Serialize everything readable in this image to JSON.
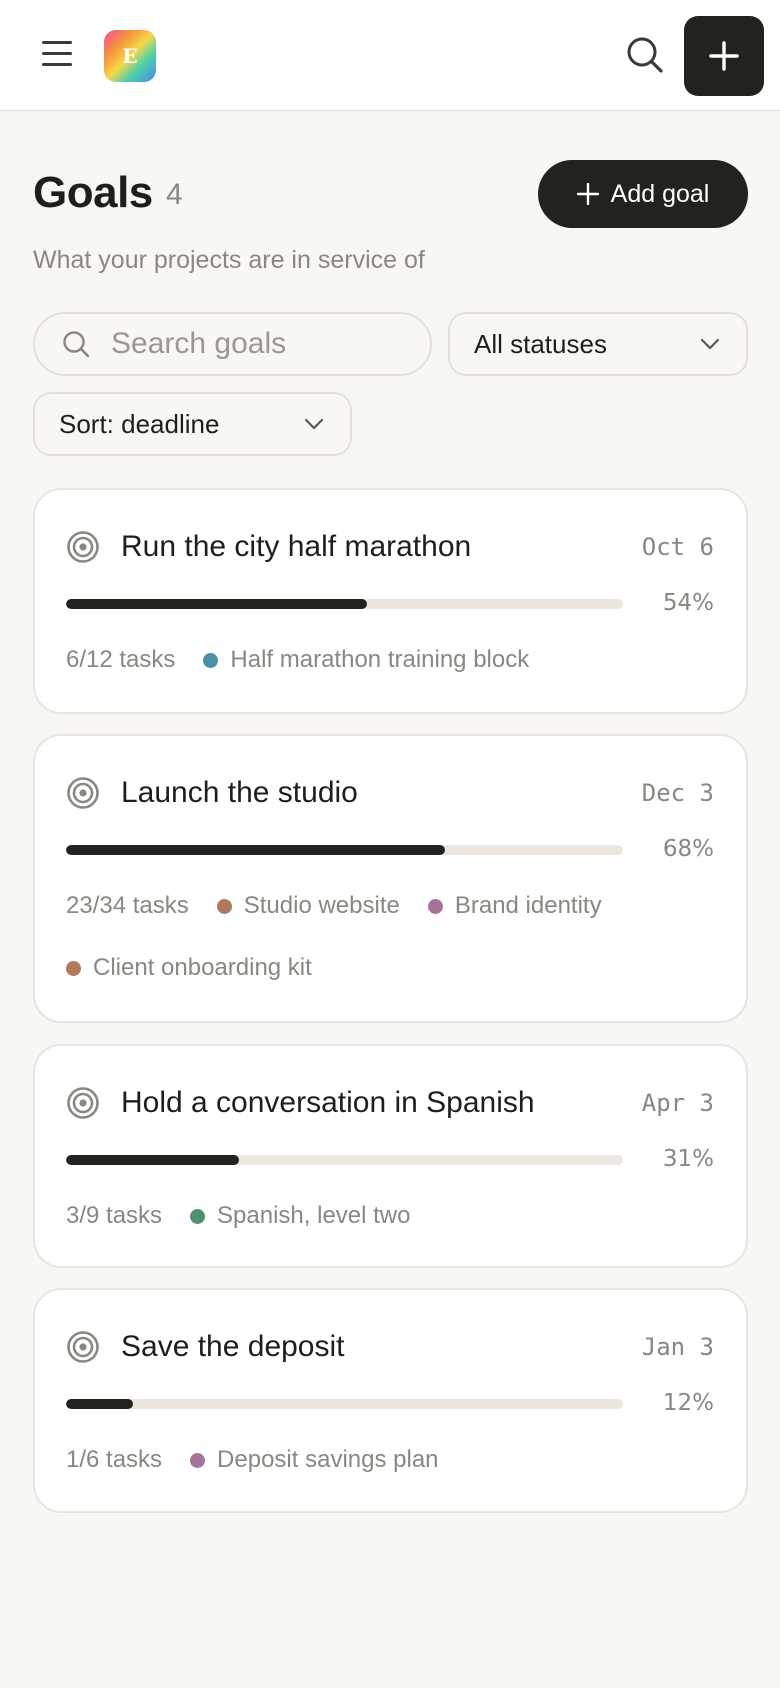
{
  "header": {
    "logo_letter": "E",
    "menu_icon": "hamburger-menu-icon",
    "search_icon": "search-icon",
    "new_icon": "plus-icon"
  },
  "page": {
    "title": "Goals",
    "count": "4",
    "subtitle": "What your projects are in service of",
    "add_goal_label": "Add goal"
  },
  "filters": {
    "search_placeholder": "Search goals",
    "status_value": "All statuses",
    "sort_value": "Sort: deadline"
  },
  "colors": {
    "accent_dark": "#23221f",
    "blue": "#4a8fa6",
    "terracotta": "#b07a5e",
    "mauve": "#a8739a",
    "green": "#4f8f72"
  },
  "goals": [
    {
      "title": "Run the city half marathon",
      "date": "Oct 6",
      "progress": 54,
      "progress_label": "54%",
      "tasks": "6/12 tasks",
      "projects": [
        {
          "name": "Half marathon training block",
          "color": "#4a8fa6"
        }
      ]
    },
    {
      "title": "Launch the studio",
      "date": "Dec 3",
      "progress": 68,
      "progress_label": "68%",
      "tasks": "23/34 tasks",
      "projects": [
        {
          "name": "Studio website",
          "color": "#b07a5e"
        },
        {
          "name": "Brand identity",
          "color": "#a8739a"
        },
        {
          "name": "Client onboarding kit",
          "color": "#b07a5e"
        }
      ]
    },
    {
      "title": "Hold a conversation in Spanish",
      "date": "Apr 3",
      "progress": 31,
      "progress_label": "31%",
      "tasks": "3/9 tasks",
      "projects": [
        {
          "name": "Spanish, level two",
          "color": "#4f8f72"
        }
      ]
    },
    {
      "title": "Save the deposit",
      "date": "Jan 3",
      "progress": 12,
      "progress_label": "12%",
      "tasks": "1/6 tasks",
      "projects": [
        {
          "name": "Deposit savings plan",
          "color": "#a8739a"
        }
      ]
    }
  ]
}
